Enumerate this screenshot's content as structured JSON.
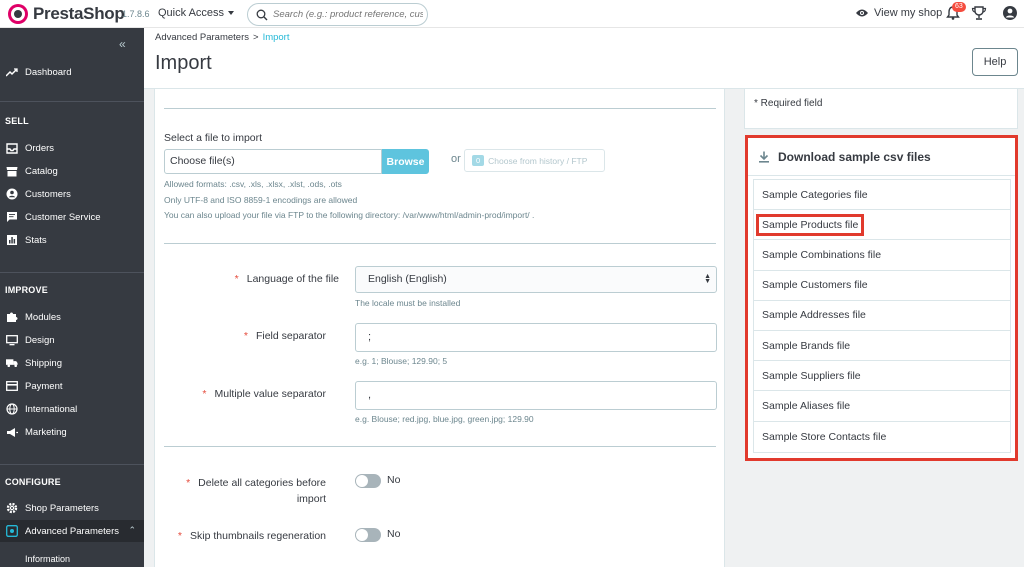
{
  "header": {
    "logo_text": "PrestaShop",
    "version": "1.7.8.6",
    "quick_access": "Quick Access",
    "search_placeholder": "Search (e.g.: product reference, custon",
    "view_shop": "View my shop",
    "notifications_count": "63"
  },
  "sidebar": {
    "dashboard": "Dashboard",
    "sections": {
      "sell": "SELL",
      "improve": "IMPROVE",
      "configure": "CONFIGURE"
    },
    "sell_items": [
      "Orders",
      "Catalog",
      "Customers",
      "Customer Service",
      "Stats"
    ],
    "improve_items": [
      "Modules",
      "Design",
      "Shipping",
      "Payment",
      "International",
      "Marketing"
    ],
    "configure_items": [
      "Shop Parameters",
      "Advanced Parameters"
    ],
    "sub_item": "Information"
  },
  "page": {
    "breadcrumb_parent": "Advanced Parameters",
    "breadcrumb_sep": ">",
    "breadcrumb_current": "Import",
    "title": "Import",
    "help": "Help"
  },
  "upload": {
    "label": "Select a file to import",
    "file_value": "Choose file(s)",
    "browse": "Browse",
    "or": "or",
    "history_badge": "0",
    "history_label": "Choose from history / FTP",
    "help_formats": "Allowed formats: .csv, .xls, .xlsx, .xlst, .ods, .ots",
    "help_encodings": "Only UTF-8 and ISO 8859-1 encodings are allowed",
    "help_ftp": "You can also upload your file via FTP to the following directory: /var/www/html/admin-prod/import/ ."
  },
  "form": {
    "required_mark": "*",
    "language_label": "Language of the file",
    "language_value": "English (English)",
    "language_help": "The locale must be installed",
    "field_sep_label": "Field separator",
    "field_sep_value": ";",
    "field_sep_help": "e.g. 1; Blouse; 129.90; 5",
    "multi_sep_label": "Multiple value separator",
    "multi_sep_value": ",",
    "multi_sep_help": "e.g. Blouse; red.jpg, blue.jpg, green.jpg; 129.90",
    "delete_cat_label_1": "Delete all categories before",
    "delete_cat_label_2": "import",
    "delete_cat_value": "No",
    "skip_thumbs_label": "Skip thumbnails regeneration",
    "skip_thumbs_value": "No"
  },
  "right": {
    "required_field": "* Required field",
    "download_title": "Download sample csv files",
    "files": [
      "Sample Categories file",
      "Sample Products file",
      "Sample Combinations file",
      "Sample Customers file",
      "Sample Addresses file",
      "Sample Brands file",
      "Sample Suppliers file",
      "Sample Aliases file",
      "Sample Store Contacts file"
    ]
  },
  "colors": {
    "accent": "#25b9d7",
    "sidebar": "#363a41",
    "highlight": "#e13a2d"
  }
}
